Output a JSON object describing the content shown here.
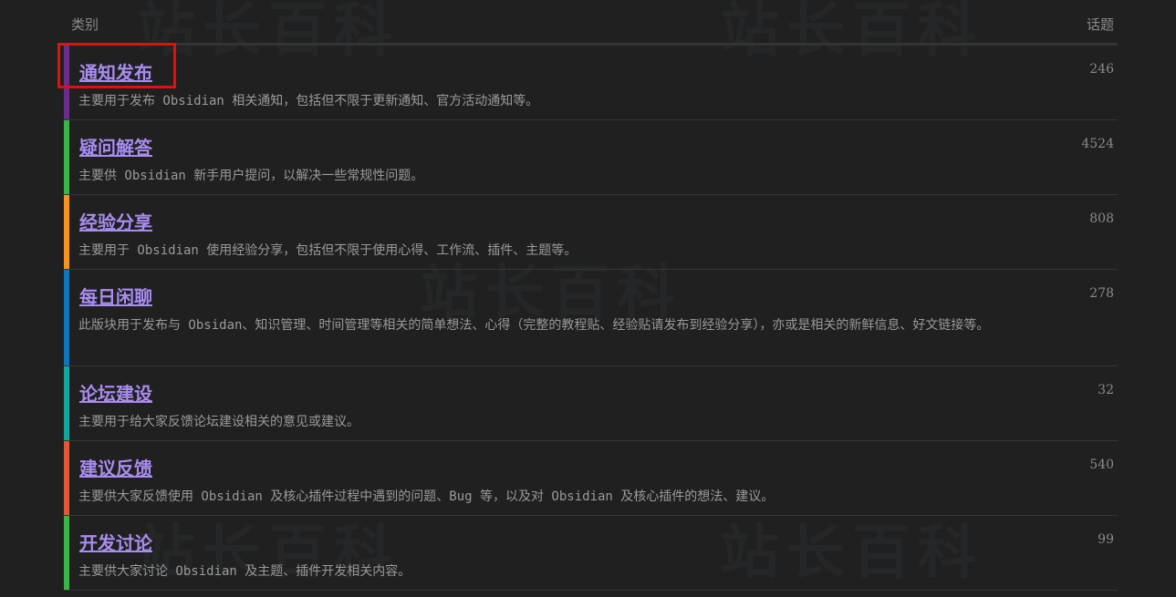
{
  "header": {
    "category_label": "类别",
    "topics_label": "话题"
  },
  "watermark_text": "站长百科",
  "categories": [
    {
      "title": "通知发布",
      "description": "主要用于发布 Obsidian 相关通知，包括但不限于更新通知、官方活动通知等。",
      "topics": "246",
      "color": "#6a2d8e"
    },
    {
      "title": "疑问解答",
      "description": "主要供 Obsidian 新手用户提问，以解决一些常规性问题。",
      "topics": "4524",
      "color": "#3ab54a"
    },
    {
      "title": "经验分享",
      "description": "主要用于 Obsidian 使用经验分享，包括但不限于使用心得、工作流、插件、主题等。",
      "topics": "808",
      "color": "#f7941d"
    },
    {
      "title": "每日闲聊",
      "description": "此版块用于发布与 Obsidan、知识管理、时间管理等相关的简单想法、心得（完整的教程贴、经验贴请发布到经验分享），亦或是相关的新鲜信息、好文链接等。",
      "topics": "278",
      "color": "#0e76bd"
    },
    {
      "title": "论坛建设",
      "description": "主要用于给大家反馈论坛建设相关的意见或建议。",
      "topics": "32",
      "color": "#12a89d"
    },
    {
      "title": "建议反馈",
      "description": "主要供大家反馈使用 Obsidian 及核心插件过程中遇到的问题、Bug 等，以及对 Obsidian 及核心插件的想法、建议。",
      "topics": "540",
      "color": "#e45735"
    },
    {
      "title": "开发讨论",
      "description": "主要供大家讨论 Obsidian 及主题、插件开发相关内容。",
      "topics": "99",
      "color": "#3ab54a"
    }
  ]
}
